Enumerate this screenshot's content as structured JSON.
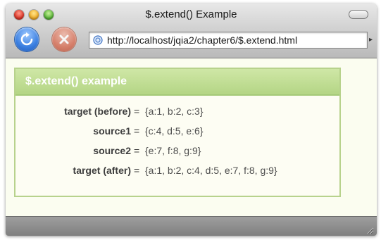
{
  "window": {
    "title": "$.extend() Example"
  },
  "toolbar": {
    "reload_icon": "reload-icon",
    "stop_icon": "stop-icon",
    "address": {
      "url": "http://localhost/jqia2/chapter6/$.extend.html",
      "site_icon": "globe-icon"
    }
  },
  "module": {
    "title": "$.extend() example",
    "rows": [
      {
        "label": "target (before)",
        "eq": "=",
        "value": "{a:1, b:2, c:3}"
      },
      {
        "label": "source1",
        "eq": "=",
        "value": "{c:4, d:5, e:6}"
      },
      {
        "label": "source2",
        "eq": "=",
        "value": "{e:7, f:8, g:9}"
      },
      {
        "label": "target (after)",
        "eq": "=",
        "value": "{a:1, b:2, c:4, d:5, e:7, f:8, g:9}"
      }
    ]
  },
  "colors": {
    "header_green": "#b4d585",
    "border_green": "#b7d28c",
    "page_background": "#fbfdf0"
  }
}
